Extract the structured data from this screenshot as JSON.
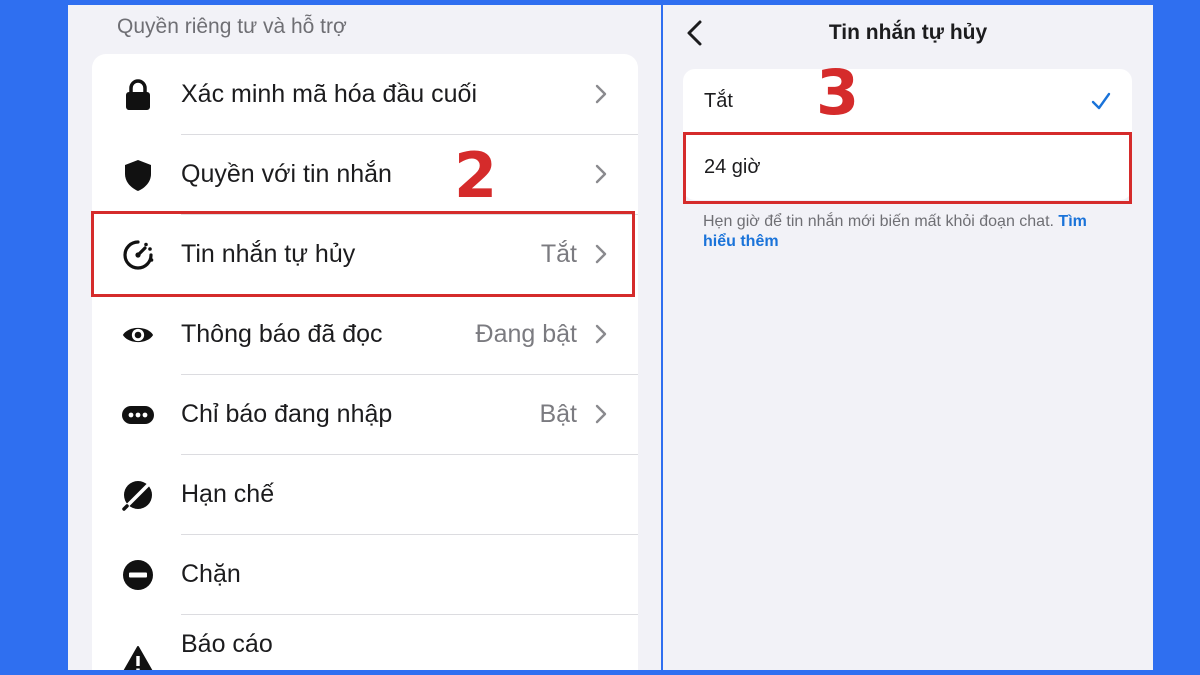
{
  "left_panel": {
    "section_header": "Quyền riêng tư và hỗ trợ",
    "items": [
      {
        "label": "Xác minh mã hóa đầu cuối",
        "value": "",
        "icon": "lock-icon"
      },
      {
        "label": "Quyền với tin nhắn",
        "value": "",
        "icon": "shield-icon"
      },
      {
        "label": "Tin nhắn tự hủy",
        "value": "Tắt",
        "icon": "timer-icon"
      },
      {
        "label": "Thông báo đã đọc",
        "value": "Đang bật",
        "icon": "eye-icon"
      },
      {
        "label": "Chỉ báo đang nhập",
        "value": "Bật",
        "icon": "typing-dots-icon"
      },
      {
        "label": "Hạn chế",
        "value": "",
        "icon": "restrict-icon"
      },
      {
        "label": "Chặn",
        "value": "",
        "icon": "block-icon"
      },
      {
        "label": "Báo cáo",
        "value": "",
        "icon": "warning-icon"
      }
    ],
    "step_label": "2"
  },
  "right_panel": {
    "title": "Tin nhắn tự hủy",
    "options": [
      {
        "label": "Tắt",
        "selected": true
      },
      {
        "label": "24 giờ",
        "selected": false
      }
    ],
    "footnote_text": "Hẹn giờ để tin nhắn mới biến mất khỏi đoạn chat.",
    "footnote_link": "Tìm hiểu thêm",
    "step_label": "3"
  },
  "colors": {
    "background": "#2f6ff0",
    "annotation_red": "#d52b2b",
    "link_blue": "#1a73d9",
    "check_blue": "#1a73d9"
  }
}
